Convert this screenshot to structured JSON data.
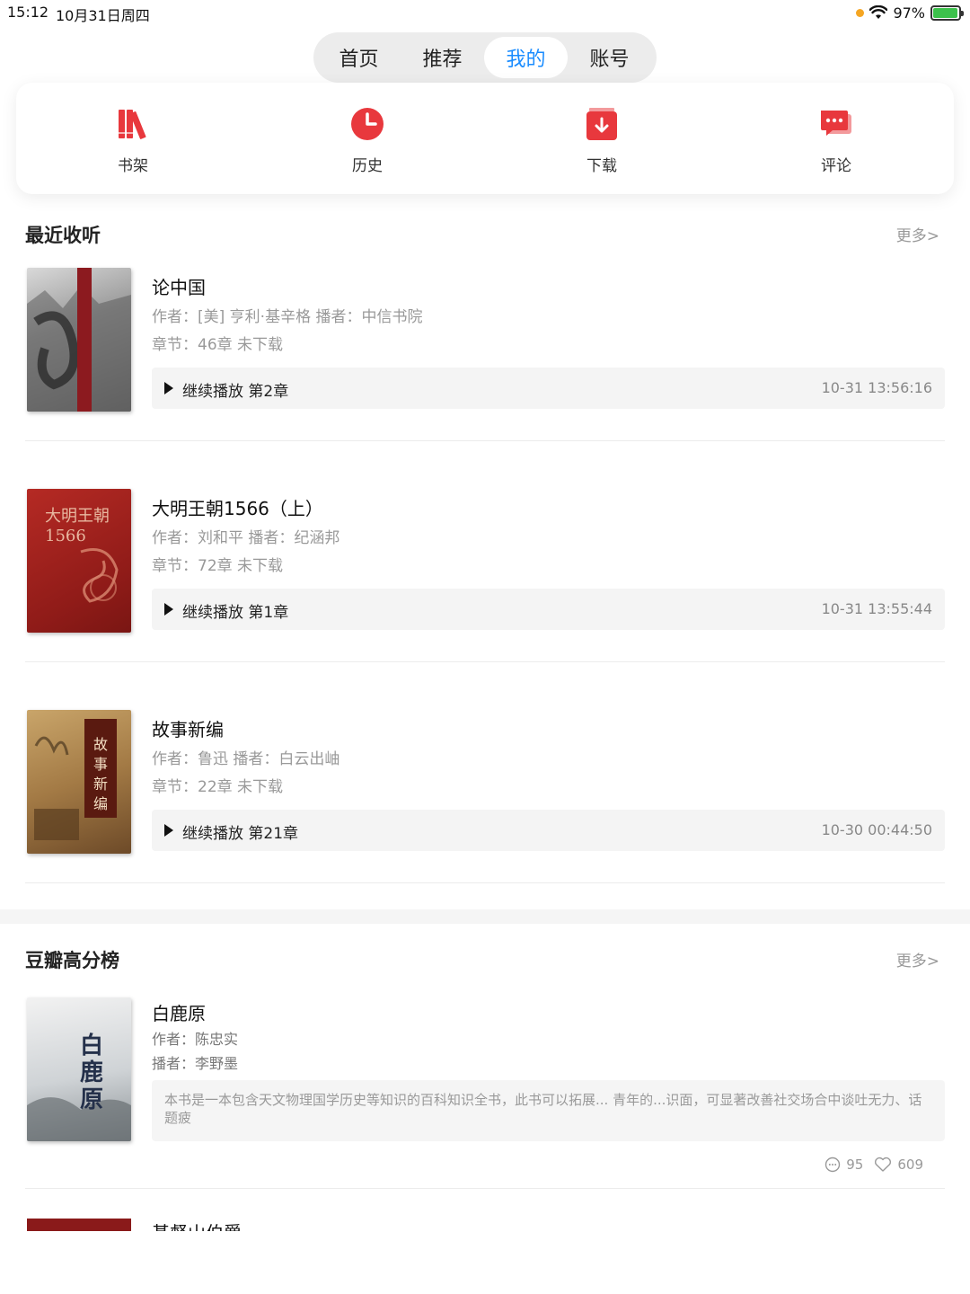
{
  "status": {
    "time": "15:12",
    "date": "10月31日周四",
    "battery": "97%",
    "battery_level": 0.97
  },
  "tabs": [
    {
      "label": "首页",
      "active": false
    },
    {
      "label": "推荐",
      "active": false
    },
    {
      "label": "我的",
      "active": true
    },
    {
      "label": "账号",
      "active": false
    }
  ],
  "quick_actions": [
    {
      "label": "书架",
      "icon": "bookshelf-icon"
    },
    {
      "label": "历史",
      "icon": "clock-icon"
    },
    {
      "label": "下载",
      "icon": "download-icon"
    },
    {
      "label": "评论",
      "icon": "comment-icon"
    }
  ],
  "colors": {
    "accent": "#1a8cff",
    "icon_red": "#e8383d"
  },
  "recent": {
    "title": "最近收听",
    "more": "更多>",
    "items": [
      {
        "title": "论中国",
        "author_line": "作者：[美] 亨利·基辛格 播者：中信书院",
        "chapter_line": "章节：46章  未下载",
        "continue": "继续播放 第2章",
        "time": "10-31 13:56:16",
        "cover_text": "论中国"
      },
      {
        "title": "大明王朝1566（上）",
        "author_line": "作者：刘和平 播者：纪涵邦",
        "chapter_line": "章节：72章  未下载",
        "continue": "继续播放 第1章",
        "time": "10-31 13:55:44",
        "cover_text": "大明王朝 1566"
      },
      {
        "title": "故事新编",
        "author_line": "作者：鲁迅 播者：白云出岫",
        "chapter_line": "章节：22章  未下载",
        "continue": "继续播放 第21章",
        "time": "10-30 00:44:50",
        "cover_text": "故事新编"
      }
    ]
  },
  "douban": {
    "title": "豆瓣高分榜",
    "more": "更多>",
    "items": [
      {
        "title": "白鹿原",
        "author": "作者：陈忠实",
        "narrator": "播者：李野墨",
        "desc": "本书是一本包含天文物理国学历史等知识的百科知识全书，此书可以拓展... 青年的...识面，可显著改善社交场合中谈吐无力、话题疲",
        "comments": "95",
        "likes": "609",
        "cover_text": "白鹿原"
      },
      {
        "title": "基督山伯爵"
      }
    ]
  }
}
